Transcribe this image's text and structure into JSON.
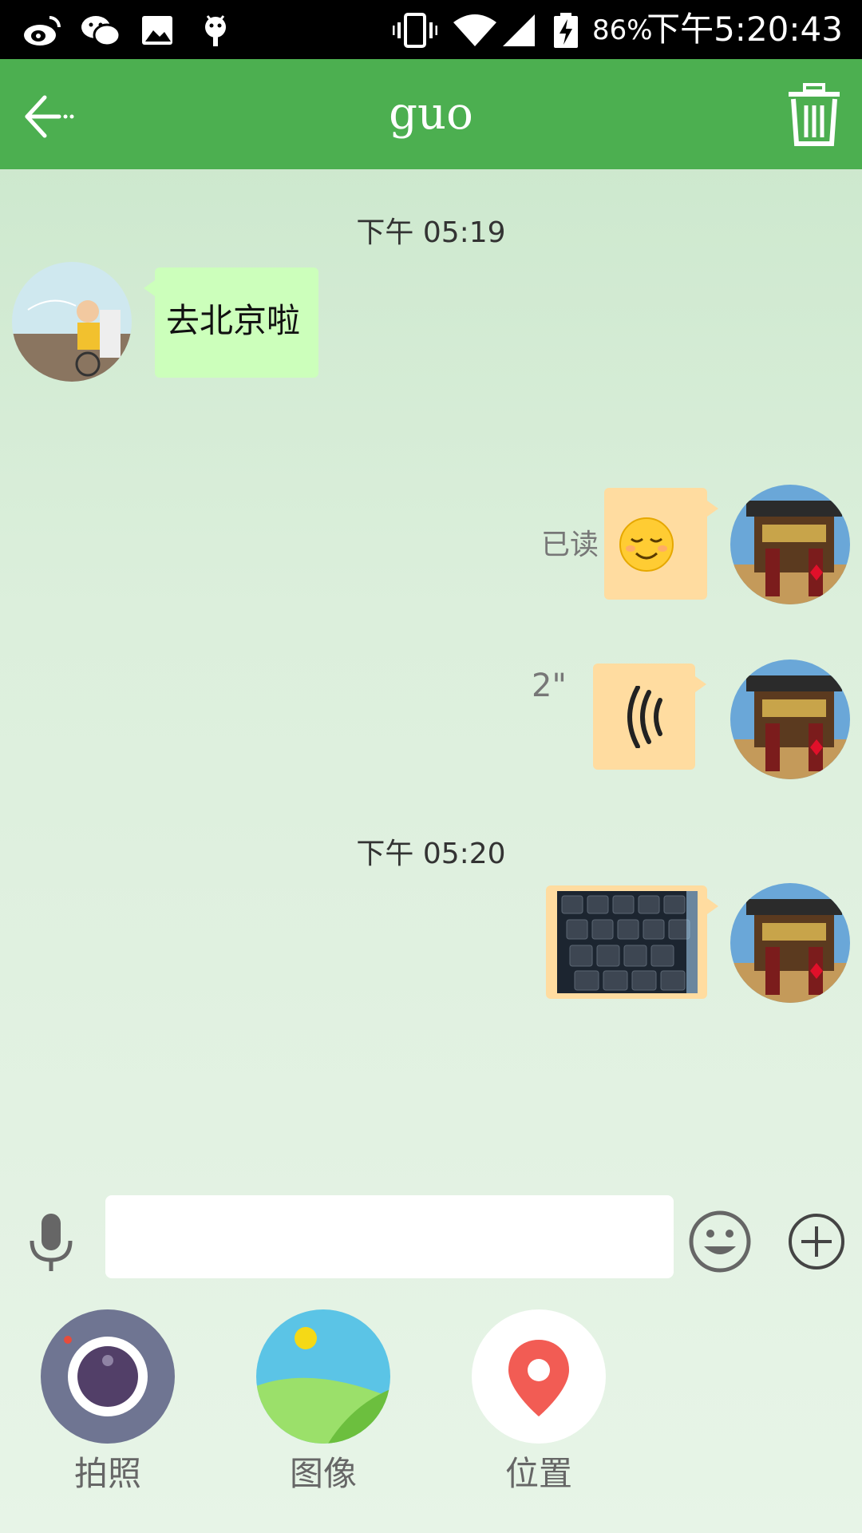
{
  "status_bar": {
    "battery": "86%",
    "time": "下午5:20:43"
  },
  "header": {
    "title": "guo"
  },
  "messages": [
    {
      "type": "timestamp",
      "text": "下午 05:19"
    },
    {
      "type": "text",
      "direction": "incoming",
      "text": "去北京啦"
    },
    {
      "type": "emoji",
      "direction": "outgoing",
      "status": "已读",
      "emoji": "smiling-face-emoji"
    },
    {
      "type": "voice",
      "direction": "outgoing",
      "duration": "2\""
    },
    {
      "type": "timestamp",
      "text": "下午 05:20"
    },
    {
      "type": "image",
      "direction": "outgoing",
      "image": "keyboard-photo"
    }
  ],
  "input": {
    "value": "",
    "placeholder": ""
  },
  "tools": [
    {
      "label": "拍照",
      "icon": "camera-icon"
    },
    {
      "label": "图像",
      "icon": "gallery-icon"
    },
    {
      "label": "位置",
      "icon": "location-icon"
    }
  ],
  "colors": {
    "header": "#4caf50",
    "incoming_bubble": "#ccffbb",
    "outgoing_bubble": "#ffdca0"
  }
}
